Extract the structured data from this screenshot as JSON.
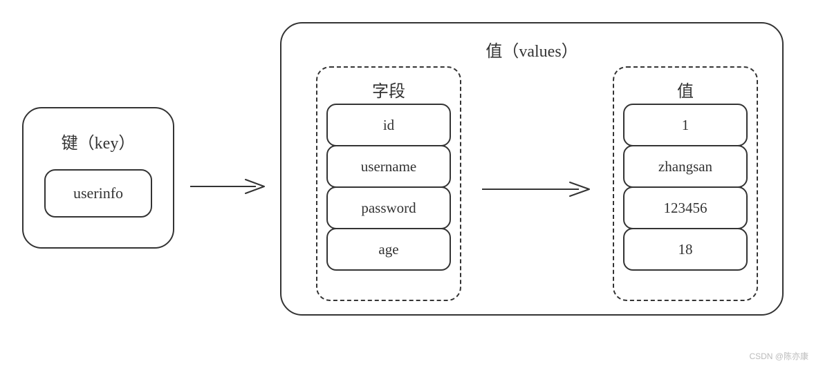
{
  "key": {
    "title": "键（key）",
    "value": "userinfo"
  },
  "values": {
    "title": "值（values）",
    "fields_title": "字段",
    "values_title": "值",
    "fields": [
      "id",
      "username",
      "password",
      "age"
    ],
    "vals": [
      "1",
      "zhangsan",
      "123456",
      "18"
    ]
  },
  "watermark": "CSDN @陈亦康"
}
